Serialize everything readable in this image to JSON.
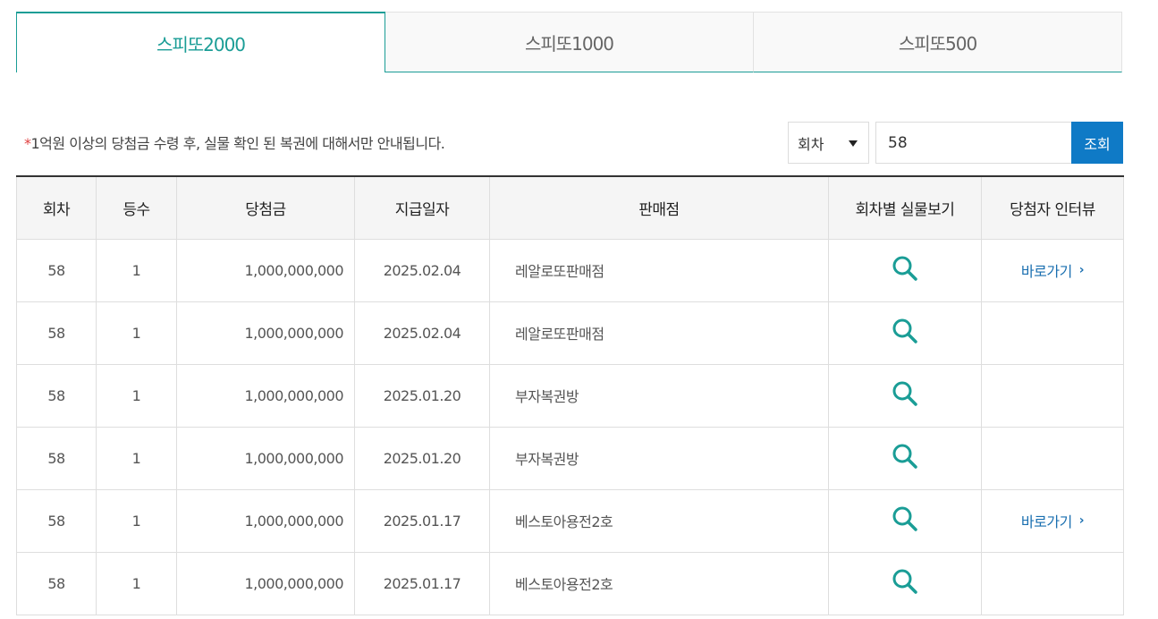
{
  "tabs": [
    {
      "label": "스피또2000",
      "active": true
    },
    {
      "label": "스피또1000",
      "active": false
    },
    {
      "label": "스피또500",
      "active": false
    }
  ],
  "notice": {
    "star": "*",
    "text": "1억원 이상의 당첨금 수령 후, 실물 확인 된 복권에 대해서만 안내됩니다."
  },
  "search": {
    "select_label": "회차",
    "input_value": "58",
    "button_label": "조회"
  },
  "table": {
    "headers": [
      "회차",
      "등수",
      "당첨금",
      "지급일자",
      "판매점",
      "회차별 실물보기",
      "당첨자 인터뷰"
    ],
    "rows": [
      {
        "round": "58",
        "rank": "1",
        "amount": "1,000,000,000",
        "date": "2025.02.04",
        "store": "레알로또판매점",
        "interview": "바로가기"
      },
      {
        "round": "58",
        "rank": "1",
        "amount": "1,000,000,000",
        "date": "2025.02.04",
        "store": "레알로또판매점",
        "interview": ""
      },
      {
        "round": "58",
        "rank": "1",
        "amount": "1,000,000,000",
        "date": "2025.01.20",
        "store": "부자복권방",
        "interview": ""
      },
      {
        "round": "58",
        "rank": "1",
        "amount": "1,000,000,000",
        "date": "2025.01.20",
        "store": "부자복권방",
        "interview": ""
      },
      {
        "round": "58",
        "rank": "1",
        "amount": "1,000,000,000",
        "date": "2025.01.17",
        "store": "베스토아용전2호",
        "interview": "바로가기"
      },
      {
        "round": "58",
        "rank": "1",
        "amount": "1,000,000,000",
        "date": "2025.01.17",
        "store": "베스토아용전2호",
        "interview": ""
      }
    ]
  },
  "icons": {
    "view": "magnifier-icon",
    "link_arrow": "chevron-right-icon"
  },
  "colors": {
    "accent": "#1a9d96",
    "button": "#0f7ac6",
    "link": "#1a6fb0",
    "required": "#e04040"
  }
}
